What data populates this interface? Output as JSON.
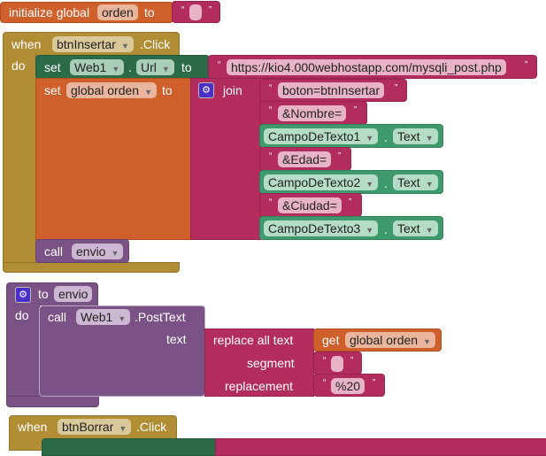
{
  "init": {
    "label": "initialize global",
    "var": "orden",
    "to": "to",
    "value": ""
  },
  "event1": {
    "when": "when",
    "component": "btnInsertar",
    "event": ".Click",
    "do": "do",
    "set_url": {
      "set": "set",
      "component": "Web1",
      "dot": ".",
      "property": "Url",
      "to": "to",
      "value": "https://kio4.000webhostapp.com/mysqli_post.php"
    },
    "set_orden": {
      "set": "set",
      "var": "global orden",
      "to": "to",
      "join": "join"
    },
    "join_items": [
      {
        "type": "text",
        "value": "boton=btnInsertar"
      },
      {
        "type": "text",
        "value": "&Nombre="
      },
      {
        "type": "component",
        "component": "CampoDeTexto1",
        "property": "Text"
      },
      {
        "type": "text",
        "value": "&Edad="
      },
      {
        "type": "component",
        "component": "CampoDeTexto2",
        "property": "Text"
      },
      {
        "type": "text",
        "value": "&Ciudad="
      },
      {
        "type": "component",
        "component": "CampoDeTexto3",
        "property": "Text"
      }
    ],
    "call": {
      "call": "call",
      "procedure": "envio"
    }
  },
  "procedure": {
    "to": "to",
    "name": "envio",
    "do": "do",
    "call": {
      "call": "call",
      "component": "Web1",
      "method": ".PostText",
      "arg": "text"
    },
    "replace": {
      "label": "replace all text",
      "segment": "segment",
      "replacement": "replacement",
      "get": "get",
      "var": "global orden",
      "segment_value": "",
      "replacement_value": "%20"
    }
  },
  "event2": {
    "when": "when",
    "component": "btnBorrar",
    "event": ".Click"
  },
  "quote_open": "“",
  "quote_close": "”",
  "dot": "."
}
